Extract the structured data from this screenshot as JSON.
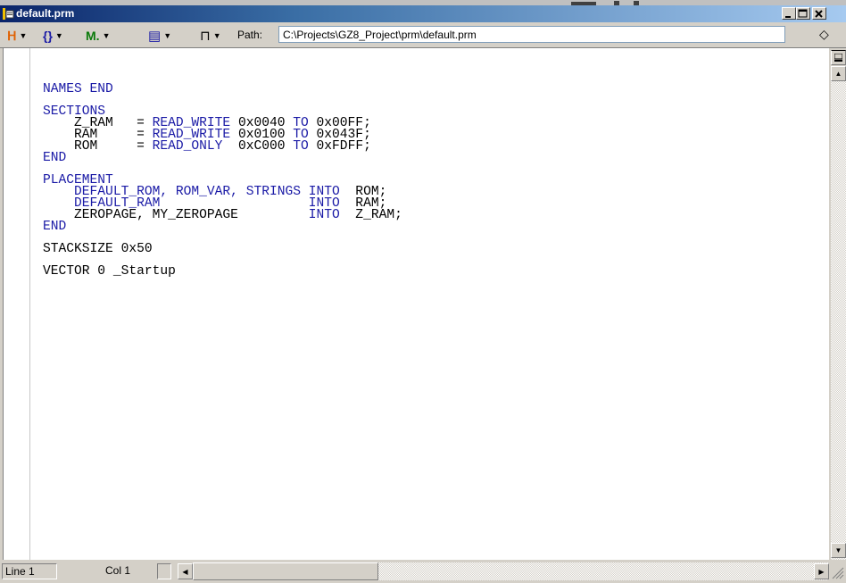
{
  "window": {
    "title": "default.prm"
  },
  "toolbar": {
    "tools": [
      {
        "name": "compile-icon",
        "glyph": "ᕼ",
        "color": "#e06000"
      },
      {
        "name": "braces-icon",
        "glyph": "{}",
        "color": "#1a1aa6"
      },
      {
        "name": "make-icon",
        "glyph": "M.",
        "color": "#0a7a0a"
      },
      {
        "name": "document-icon",
        "glyph": "▤",
        "color": "#1a1aa6"
      },
      {
        "name": "lock-icon",
        "glyph": "⊓",
        "color": "#000000"
      }
    ],
    "path_label": "Path:",
    "path_value": "C:\\Projects\\GZ8_Project\\prm\\default.prm",
    "diamond_glyph": "◇"
  },
  "code_lines": [
    [
      {
        "t": "NAMES END",
        "k": true
      }
    ],
    [],
    [
      {
        "t": "SECTIONS",
        "k": true
      }
    ],
    [
      {
        "t": "    Z_RAM   = ",
        "k": false
      },
      {
        "t": "READ_WRITE",
        "k": true
      },
      {
        "t": " 0x0040 ",
        "k": false
      },
      {
        "t": "TO",
        "k": true
      },
      {
        "t": " 0x00FF;",
        "k": false
      }
    ],
    [
      {
        "t": "    RAM     = ",
        "k": false
      },
      {
        "t": "READ_WRITE",
        "k": true
      },
      {
        "t": " 0x0100 ",
        "k": false
      },
      {
        "t": "TO",
        "k": true
      },
      {
        "t": " 0x043F;",
        "k": false
      }
    ],
    [
      {
        "t": "    ROM     = ",
        "k": false
      },
      {
        "t": "READ_ONLY",
        "k": true
      },
      {
        "t": "  0xC000 ",
        "k": false
      },
      {
        "t": "TO",
        "k": true
      },
      {
        "t": " 0xFDFF;",
        "k": false
      }
    ],
    [
      {
        "t": "END",
        "k": true
      }
    ],
    [],
    [
      {
        "t": "PLACEMENT",
        "k": true
      }
    ],
    [
      {
        "t": "    DEFAULT_ROM, ROM_VAR, STRINGS ",
        "k": true
      },
      {
        "t": "INTO",
        "k": true
      },
      {
        "t": "  ROM;",
        "k": false
      }
    ],
    [
      {
        "t": "    DEFAULT_RAM                   ",
        "k": true
      },
      {
        "t": "INTO",
        "k": true
      },
      {
        "t": "  RAM;",
        "k": false
      }
    ],
    [
      {
        "t": "    ZEROPAGE, MY_ZEROPAGE         ",
        "k": false
      },
      {
        "t": "INTO",
        "k": true
      },
      {
        "t": "  Z_RAM;",
        "k": false
      }
    ],
    [
      {
        "t": "END",
        "k": true
      }
    ],
    [],
    [
      {
        "t": "STACKSIZE 0x50",
        "k": false
      }
    ],
    [],
    [
      {
        "t": "VECTOR 0 _Startup",
        "k": false
      }
    ]
  ],
  "status": {
    "line": "Line 1",
    "col": "Col 1"
  },
  "colors": {
    "keyword": "#1a1aa6",
    "title_start": "#0a246a",
    "title_end": "#a6caf0"
  }
}
